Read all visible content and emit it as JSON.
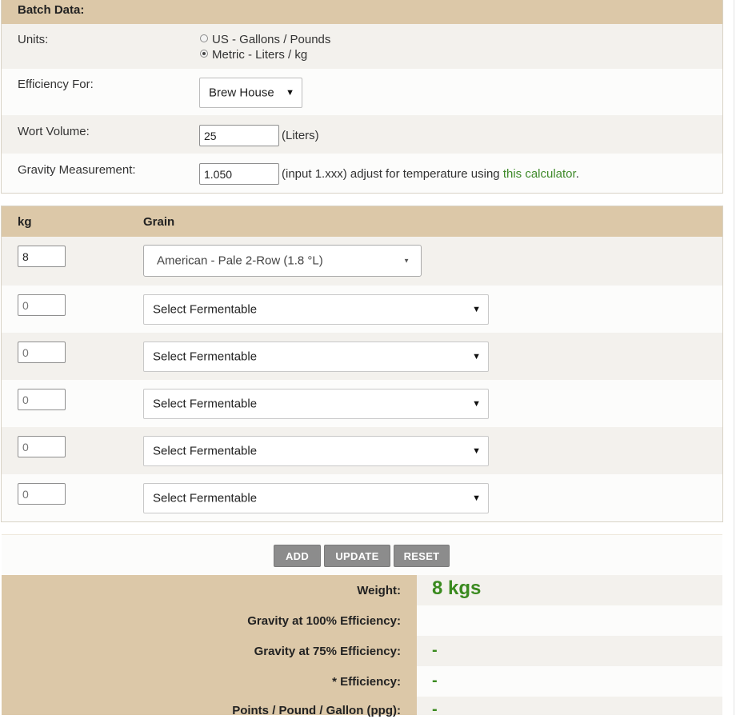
{
  "batch": {
    "header": "Batch Data:",
    "units_label": "Units:",
    "units_options": [
      "US - Gallons / Pounds",
      "Metric - Liters / kg"
    ],
    "units_selected_index": 1,
    "efficiency_label": "Efficiency For:",
    "efficiency_value": "Brew House",
    "wort_label": "Wort Volume:",
    "wort_value": "25",
    "wort_unit": "(Liters)",
    "gravity_label": "Gravity Measurement:",
    "gravity_value": "1.050",
    "gravity_hint": "(input 1.xxx) adjust for temperature using",
    "gravity_link": "this calculator",
    "gravity_period": "."
  },
  "grains": {
    "col_weight": "kg",
    "col_grain": "Grain",
    "rows": [
      {
        "weight": "8",
        "grain": "American - Pale 2-Row (1.8 °L)",
        "placeholder": "0"
      },
      {
        "weight": "",
        "grain": "Select Fermentable",
        "placeholder": "0"
      },
      {
        "weight": "",
        "grain": "Select Fermentable",
        "placeholder": "0"
      },
      {
        "weight": "",
        "grain": "Select Fermentable",
        "placeholder": "0"
      },
      {
        "weight": "",
        "grain": "Select Fermentable",
        "placeholder": "0"
      },
      {
        "weight": "",
        "grain": "Select Fermentable",
        "placeholder": "0"
      }
    ]
  },
  "buttons": {
    "add": "ADD",
    "update": "UPDATE",
    "reset": "RESET"
  },
  "results": {
    "weight_label": "Weight:",
    "weight_value": "8 kgs",
    "gravity100_label": "Gravity at 100% Efficiency:",
    "gravity100_value": "",
    "gravity75_label": "Gravity at 75% Efficiency:",
    "gravity75_value": "-",
    "efficiency_label": "* Efficiency:",
    "efficiency_value": "-",
    "ppg_label": "Points / Pound / Gallon (ppg):",
    "ppg_value": "-"
  },
  "colors": {
    "header_tan": "#dcc8a8",
    "accent_green": "#3a8a1f",
    "button_gray": "#8c8c8c"
  }
}
